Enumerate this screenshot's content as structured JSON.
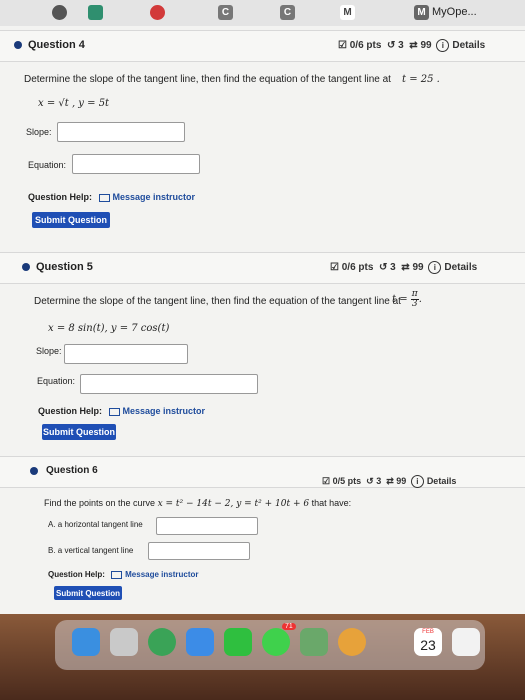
{
  "browser": {
    "active_tab_title": "MyOpe...",
    "tab_icons": [
      {
        "name": "favicon-dark-icon",
        "color": "#555555",
        "glyph": ""
      },
      {
        "name": "favicon-teal-icon",
        "color": "#2f8f6f",
        "glyph": ""
      },
      {
        "name": "favicon-red-icon",
        "color": "#d23a3a",
        "glyph": ""
      },
      {
        "name": "chegg-c-icon",
        "color": "#777777",
        "glyph": "C"
      },
      {
        "name": "chegg-c-icon-2",
        "color": "#777777",
        "glyph": "C"
      },
      {
        "name": "mail-m-icon",
        "color": "#ffffff",
        "glyph": "M"
      },
      {
        "name": "myopenmath-m-icon",
        "color": "#666666",
        "glyph": "M"
      }
    ]
  },
  "questions": [
    {
      "title": "Question 4",
      "score": "0/6 pts",
      "attempts": "3",
      "retries": "99",
      "details": "Details",
      "prompt": "Determine the slope of the tangent line, then find the equation of the tangent line at",
      "t_value": "t = 25 .",
      "equations": "x = √t , y = 5t",
      "fields": [
        "Slope:",
        "Equation:"
      ],
      "help_label": "Question Help:",
      "help_link": "Message instructor",
      "submit": "Submit Question"
    },
    {
      "title": "Question 5",
      "score": "0/6 pts",
      "attempts": "3",
      "retries": "99",
      "details": "Details",
      "prompt": "Determine the slope of the tangent line, then find the equation of the tangent line at",
      "t_lhs": "t =",
      "t_num": "π",
      "t_den": "3",
      "equations": "x = 8 sin(t), y = 7 cos(t)",
      "fields": [
        "Slope:",
        "Equation:"
      ],
      "help_label": "Question Help:",
      "help_link": "Message instructor",
      "submit": "Submit Question"
    },
    {
      "title": "Question 6",
      "score": "0/5 pts",
      "attempts": "3",
      "retries": "99",
      "details": "Details",
      "prompt": "Find the points on the curve",
      "equations": "x = t² − 14t − 2, y = t² + 10t + 6",
      "prompt_end": "that have:",
      "fields": [
        "A. a horizontal tangent line",
        "B. a vertical tangent line"
      ],
      "help_label": "Question Help:",
      "help_link": "Message instructor",
      "submit": "Submit Question"
    }
  ],
  "dock": {
    "calendar_month": "FEB",
    "calendar_day": "23",
    "badge": "71",
    "apps": [
      {
        "name": "finder-icon",
        "color": "#3a8fe0"
      },
      {
        "name": "launchpad-icon",
        "color": "#c9c9c9"
      },
      {
        "name": "chrome-icon",
        "color": "#3aa357"
      },
      {
        "name": "mail-app-icon",
        "color": "#3c8ce7"
      },
      {
        "name": "facetime-icon",
        "color": "#2fbf3f"
      },
      {
        "name": "messages-icon",
        "color": "#3fd14c"
      },
      {
        "name": "maps-icon",
        "color": "#6aa86a"
      },
      {
        "name": "photos-icon",
        "color": "#e7a23a"
      },
      {
        "name": "calendar-icon",
        "color": "#ffffff"
      },
      {
        "name": "reminders-icon",
        "color": "#f2f2f2"
      }
    ]
  }
}
